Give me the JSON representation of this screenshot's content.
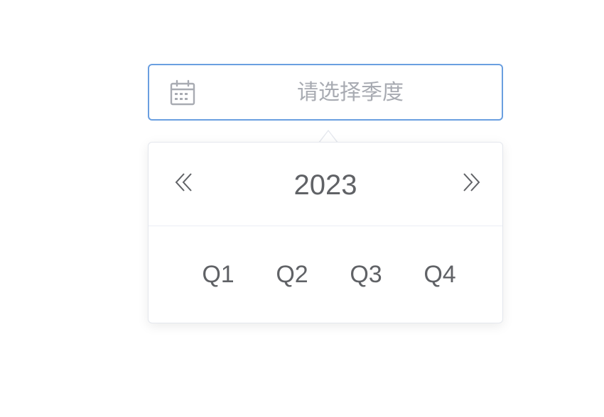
{
  "picker": {
    "placeholder": "请选择季度",
    "value": "",
    "icon": "calendar-icon",
    "focus_border_color": "#6a9fe0"
  },
  "panel": {
    "year": "2023",
    "prev_icon": "double-chevron-left-icon",
    "next_icon": "double-chevron-right-icon",
    "quarters": [
      "Q1",
      "Q2",
      "Q3",
      "Q4"
    ],
    "text_color": "#606266"
  }
}
